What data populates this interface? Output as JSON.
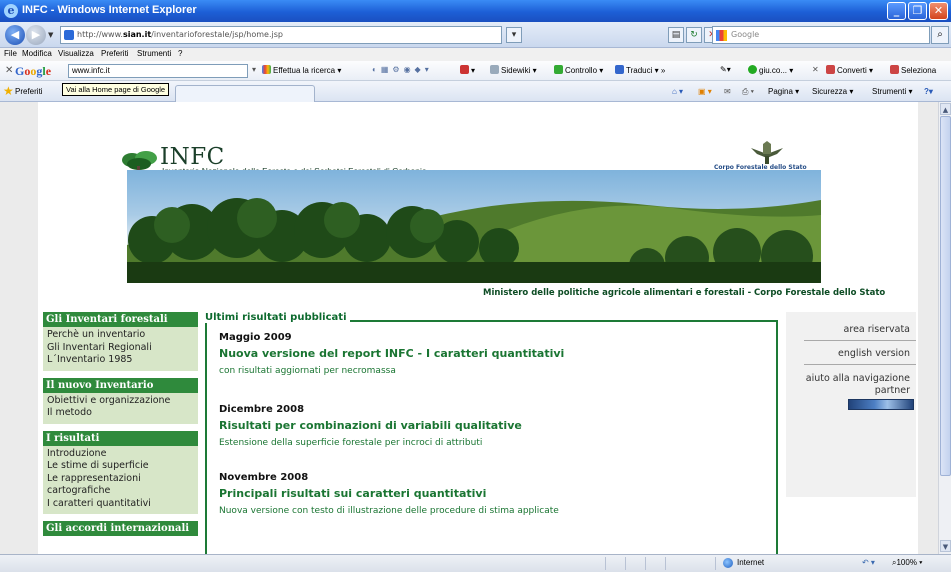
{
  "window": {
    "title": "INFC - Windows Internet Explorer"
  },
  "address_bar": {
    "url_prefix": "http://www.",
    "url_host": "sian.it",
    "url_path": "/inventarioforestale/jsp/home.jsp",
    "search_placeholder": "Google"
  },
  "menu": [
    "File",
    "Modifica",
    "Visualizza",
    "Preferiti",
    "Strumenti",
    "?"
  ],
  "google_toolbar": {
    "logo": {
      "G": "G",
      "o1": "o",
      "o2": "o",
      "g": "g",
      "l": "l",
      "e": "e"
    },
    "search_value": "www.infc.it",
    "search_button": "Effettua la ricerca",
    "sidewiki": "Sidewiki",
    "check": "Controllo",
    "translate": "Traduci",
    "more": "»",
    "giu": "giu.co...",
    "convert": "Converti",
    "select": "Seleziona"
  },
  "favorites_bar": {
    "label": "Preferiti",
    "tooltip": "Vai alla Home page di Google",
    "commands": {
      "page": "Pagina",
      "security": "Sicurezza",
      "tools": "Strumenti"
    }
  },
  "header": {
    "logo_text": "INFC",
    "subtitle": "Inventario Nazionale delle Foreste e dei Serbatoi Forestali di Carbonio",
    "corpo_label": "Corpo Forestale dello Stato",
    "ministry": "Ministero delle politiche agricole alimentari e forestali - Corpo Forestale dello Stato"
  },
  "left_nav": [
    {
      "heading": "Gli Inventari forestali",
      "items": [
        "Perchè un inventario",
        "Gli Inventari Regionali",
        "L´Inventario 1985"
      ]
    },
    {
      "heading": "Il nuovo Inventario",
      "items": [
        "Obiettivi e organizzazione",
        "Il metodo"
      ]
    },
    {
      "heading": "I risultati",
      "items": [
        "Introduzione",
        "Le stime di superficie",
        "Le rappresentazioni",
        "cartografiche",
        "I caratteri quantitativi"
      ]
    },
    {
      "heading": "Gli accordi internazionali",
      "items": []
    }
  ],
  "news": {
    "legend": "Ultimi risultati pubblicati",
    "items": [
      {
        "date": "Maggio 2009",
        "title": "Nuova versione del report INFC - I caratteri quantitativi",
        "desc": "con risultati aggiornati per necromassa"
      },
      {
        "date": "Dicembre 2008",
        "title": "Risultati per combinazioni di variabili qualitative",
        "desc": "Estensione della superficie forestale per incroci di attributi"
      },
      {
        "date": "Novembre 2008",
        "title": "Principali risultati sui caratteri quantitativi",
        "desc": "Nuova versione con testo di illustrazione delle procedure di stima applicate"
      }
    ]
  },
  "right_col": {
    "reserved": "area riservata",
    "english": "english version",
    "help": "aiuto alla navigazione",
    "partner": "partner"
  },
  "status_bar": {
    "zone": "Internet",
    "zoom": "100%"
  }
}
